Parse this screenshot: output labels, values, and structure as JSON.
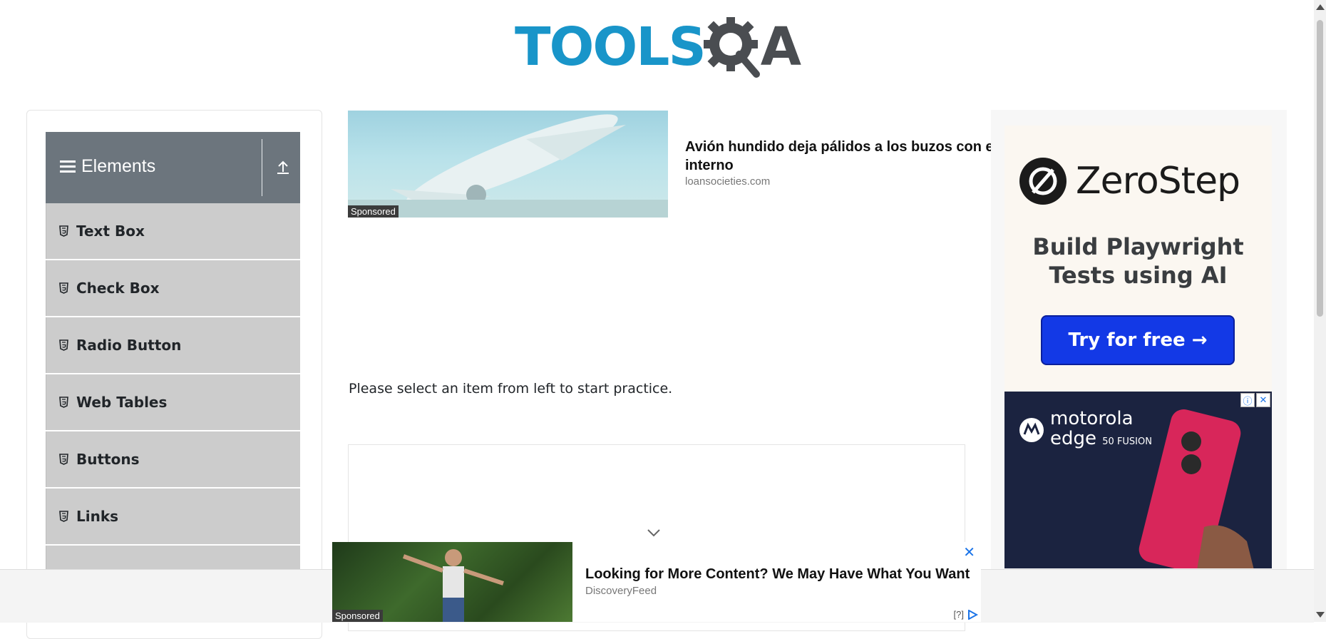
{
  "header": {
    "logo_part1": "TOOLS",
    "logo_part2": "A"
  },
  "sidebar": {
    "group_title": "Elements",
    "items": [
      {
        "label": "Text Box"
      },
      {
        "label": "Check Box"
      },
      {
        "label": "Radio Button"
      },
      {
        "label": "Web Tables"
      },
      {
        "label": "Buttons"
      },
      {
        "label": "Links"
      }
    ]
  },
  "top_ad": {
    "sponsored": "Sponsored",
    "headline": "Avión hundido deja pálidos a los buzos con e",
    "headline_line2": "interno",
    "source": "loansocieties.com"
  },
  "main": {
    "message": "Please select an item from left to start practice."
  },
  "right_ads": {
    "zerostep_name": "ZeroStep",
    "zerostep_tagline_1": "Build Playwright",
    "zerostep_tagline_2": "Tests using AI",
    "zerostep_cta": "Try for free →",
    "moto_brand": "motorola",
    "moto_model": "edge",
    "moto_sub": "50 FUSION"
  },
  "bottom_ad": {
    "sponsored": "Sponsored",
    "headline": "Looking for More Content? We May Have What You Want",
    "source": "DiscoveryFeed",
    "adchoice": "[?]"
  },
  "colors": {
    "logo_blue": "#1995c9",
    "logo_dark": "#4a4d51",
    "group_header": "#6c757d",
    "menu_item": "#cccccc",
    "cta_blue": "#1339e6"
  }
}
